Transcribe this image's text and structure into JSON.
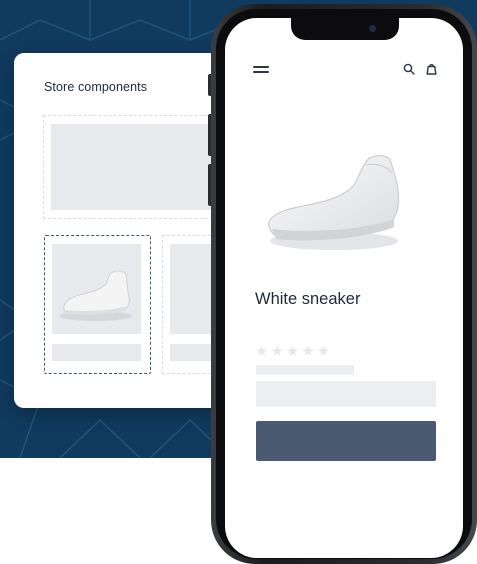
{
  "store_panel": {
    "title": "Store components"
  },
  "product": {
    "name": "White sneaker",
    "rating": 0,
    "rating_max": 5
  },
  "icons": {
    "menu": "hamburger-menu-icon",
    "search": "search-icon",
    "cart": "shopping-bag-icon"
  },
  "colors": {
    "background": "#103a5e",
    "pattern_line": "#2e6b9a",
    "text_dark": "#1d2a3a",
    "placeholder": "#e8e9ec",
    "selected_border": "#3f5675",
    "cta": "#4a5a70",
    "phone_frame": "#1b1c1f"
  }
}
